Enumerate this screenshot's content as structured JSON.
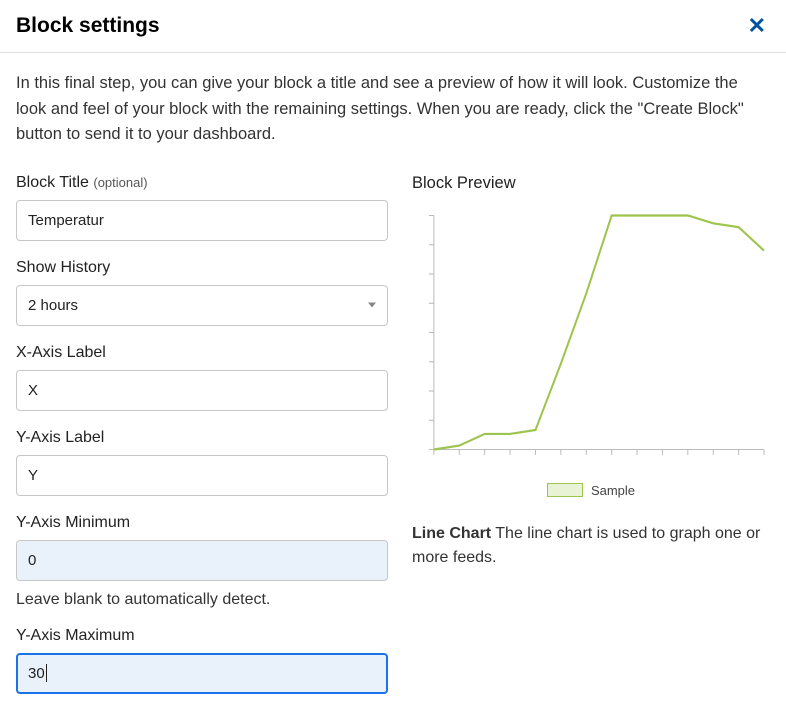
{
  "header": {
    "title": "Block settings"
  },
  "intro": "In this final step, you can give your block a title and see a preview of how it will look. Customize the look and feel of your block with the remaining settings. When you are ready, click the \"Create Block\" button to send it to your dashboard.",
  "form": {
    "block_title": {
      "label": "Block Title",
      "hint": "(optional)",
      "value": "Temperatur"
    },
    "show_history": {
      "label": "Show History",
      "value": "2 hours"
    },
    "x_axis": {
      "label": "X-Axis Label",
      "value": "X"
    },
    "y_axis": {
      "label": "Y-Axis Label",
      "value": "Y"
    },
    "y_min": {
      "label": "Y-Axis Minimum",
      "value": "0",
      "helper": "Leave blank to automatically detect."
    },
    "y_max": {
      "label": "Y-Axis Maximum",
      "value": "30"
    }
  },
  "preview": {
    "title": "Block Preview",
    "legend_label": "Sample",
    "chart_type_name": "Line Chart",
    "chart_type_desc": "The line chart is used to graph one or more feeds."
  },
  "chart_data": {
    "type": "line",
    "title": "",
    "xlabel": "X",
    "ylabel": "Y",
    "ylim": [
      0,
      30
    ],
    "series": [
      {
        "name": "Sample",
        "values": [
          0,
          0.5,
          2,
          2,
          2.5,
          11,
          20,
          30,
          30,
          30,
          30,
          29,
          28.5,
          25.5
        ]
      }
    ],
    "x": [
      0,
      1,
      2,
      3,
      4,
      5,
      6,
      7,
      8,
      9,
      10,
      11,
      12,
      13
    ]
  }
}
